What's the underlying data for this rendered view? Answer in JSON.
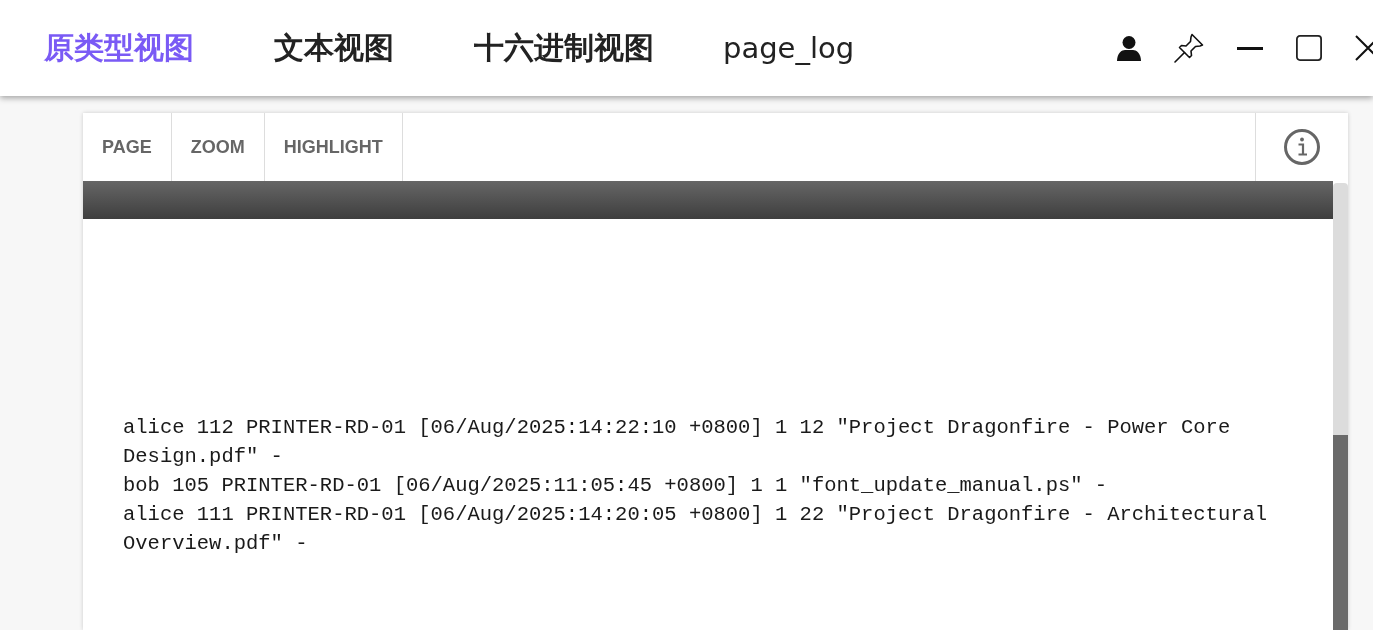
{
  "tabs": [
    {
      "label": "原类型视图",
      "selected": true
    },
    {
      "label": "文本视图",
      "selected": false
    },
    {
      "label": "十六进制视图",
      "selected": false
    }
  ],
  "file_name": "page_log",
  "toolbar": {
    "buttons": [
      "PAGE",
      "ZOOM",
      "HIGHLIGHT"
    ]
  },
  "log_lines": [
    "alice 112 PRINTER-RD-01 [06/Aug/2025:14:22:10 +0800] 1 12 \"Project Dragonfire - Power Core Design.pdf\" -",
    "bob 105 PRINTER-RD-01 [06/Aug/2025:11:05:45 +0800] 1 1 \"font_update_manual.ps\" -",
    "alice 111 PRINTER-RD-01 [06/Aug/2025:14:20:05 +0800] 1 22 \"Project Dragonfire - Architectural Overview.pdf\" -"
  ]
}
